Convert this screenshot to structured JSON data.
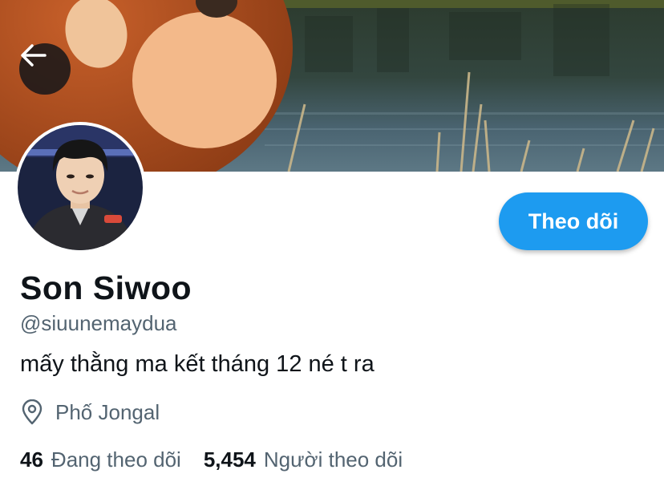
{
  "profile": {
    "name": "Son Siwoo",
    "handle": "@siuunemaydua",
    "bio": "mấy thằng ma kết tháng 12 né t ra",
    "location": "Phố Jongal",
    "following_count": "46",
    "following_label": "Đang theo dõi",
    "followers_count": "5,454",
    "followers_label": "Người theo dõi"
  },
  "actions": {
    "follow_label": "Theo dõi"
  },
  "icons": {
    "back": "arrow-left-icon",
    "location": "map-pin-icon"
  },
  "colors": {
    "accent": "#1d9bf0",
    "text_primary": "#0f1419",
    "text_secondary": "#536471"
  }
}
